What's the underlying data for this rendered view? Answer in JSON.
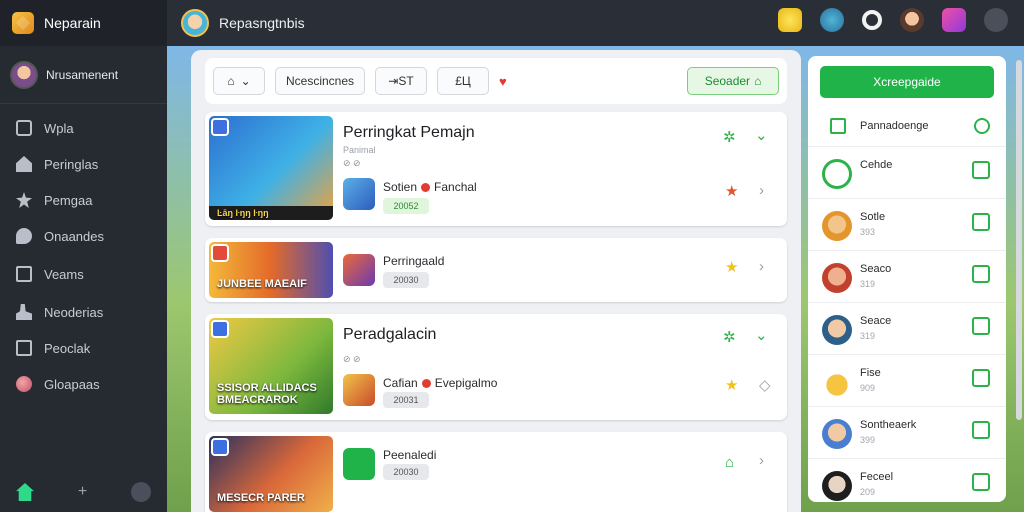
{
  "app": {
    "name": "Neparain"
  },
  "sidebar": {
    "user": "Nrusamenent",
    "items": [
      {
        "label": "Wpla",
        "icon": "box-icon"
      },
      {
        "label": "Peringlas",
        "icon": "home-icon"
      },
      {
        "label": "Pemgaa",
        "icon": "star-icon"
      },
      {
        "label": "Onaandes",
        "icon": "chat-icon"
      },
      {
        "label": "Veams",
        "icon": "mail-icon"
      },
      {
        "label": "Neoderias",
        "icon": "people-icon"
      },
      {
        "label": "Peoclak",
        "icon": "image-icon"
      },
      {
        "label": "Gloapaas",
        "icon": "ball-icon"
      }
    ],
    "footer": {
      "plus": "+"
    }
  },
  "topbar": {
    "title": "Repasngtnbis"
  },
  "filters": {
    "search_label": "Ncescincnes",
    "chip_a": "⇥ST",
    "chip_b": "£Ц",
    "green_button": "Seoader"
  },
  "cards": [
    {
      "thumb_text": "Ŀāŋ ŀŋŋ ŀŋŋ",
      "title": "Perringkat Pemajn",
      "sub": "Panimal",
      "meta": "⊘ ⊘",
      "user": "Sotien",
      "user2": "Fanchal",
      "pill": "20052"
    },
    {
      "thumb_text": "JUNBEE MAEAIF",
      "title": "",
      "user": "Perringaald",
      "pill": "20030"
    },
    {
      "thumb_text": "SSISOR ALLIDACS BMEACRAROK",
      "title": "Peradgalacin",
      "meta": "⊘ ⊘",
      "user": "Cafian",
      "user2": "Evepigalmo",
      "pill": "20031"
    },
    {
      "thumb_text": "MESECR PARER",
      "title": "",
      "user": "Peenaledi",
      "pill": "20030"
    }
  ],
  "rpanel": {
    "button": "Xcreepgaide",
    "items": [
      {
        "name": "Pannadoenge",
        "num": ""
      },
      {
        "name": "Cehde",
        "num": ""
      },
      {
        "name": "Sotle",
        "num": "393"
      },
      {
        "name": "Seaco",
        "num": "319"
      },
      {
        "name": "Seace",
        "num": "319"
      },
      {
        "name": "Fise",
        "num": "909"
      },
      {
        "name": "Sontheaerk",
        "num": "399"
      },
      {
        "name": "Feceel",
        "num": "209"
      }
    ]
  }
}
